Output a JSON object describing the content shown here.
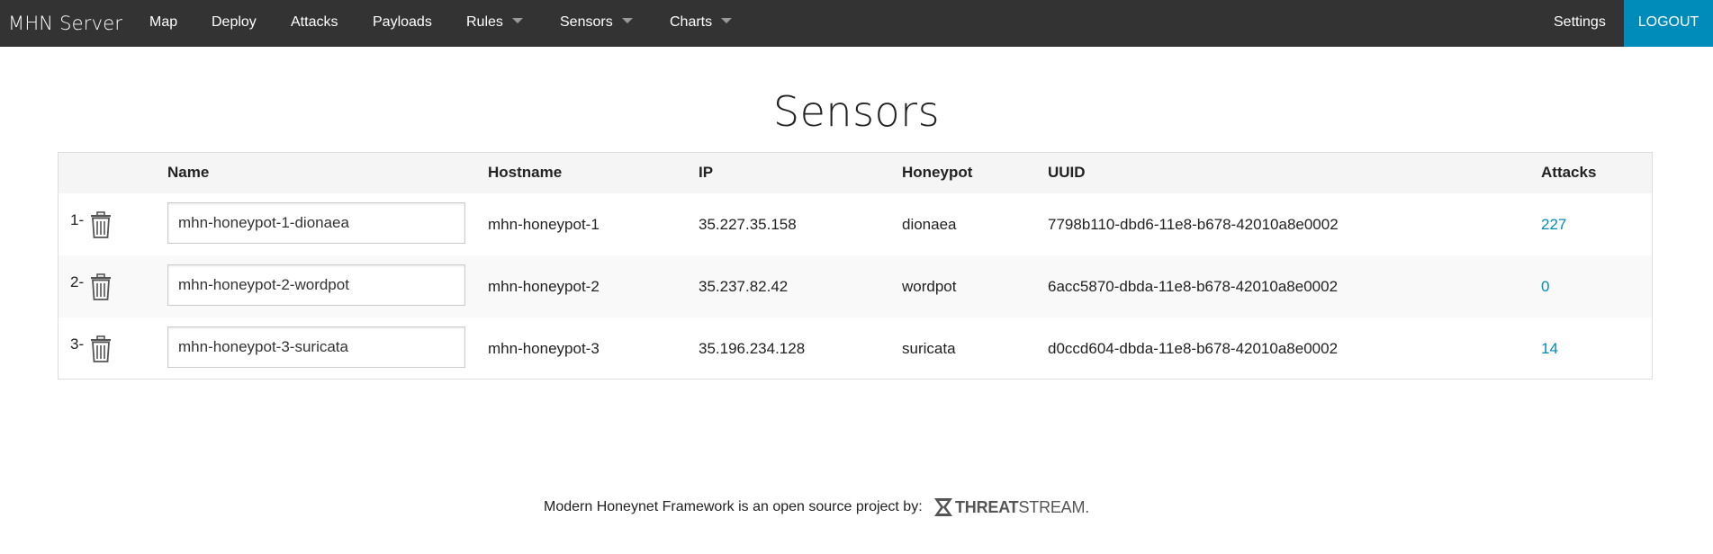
{
  "navbar": {
    "brand": "MHN Server",
    "items": [
      {
        "label": "Map"
      },
      {
        "label": "Deploy"
      },
      {
        "label": "Attacks"
      },
      {
        "label": "Payloads"
      },
      {
        "label": "Rules"
      },
      {
        "label": "Sensors"
      },
      {
        "label": "Charts"
      }
    ],
    "settings": "Settings",
    "logout": "LOGOUT"
  },
  "page": {
    "title": "Sensors"
  },
  "table": {
    "headers": [
      "Name",
      "Hostname",
      "IP",
      "Honeypot",
      "UUID",
      "Attacks"
    ],
    "rows": [
      {
        "num": "1-",
        "name": "mhn-honeypot-1-dionaea",
        "hostname": "mhn-honeypot-1",
        "ip": "35.227.35.158",
        "honeypot": "dionaea",
        "uuid": "7798b110-dbd6-11e8-b678-42010a8e0002",
        "attacks": "227"
      },
      {
        "num": "2-",
        "name": "mhn-honeypot-2-wordpot",
        "hostname": "mhn-honeypot-2",
        "ip": "35.237.82.42",
        "honeypot": "wordpot",
        "uuid": "6acc5870-dbda-11e8-b678-42010a8e0002",
        "attacks": "0"
      },
      {
        "num": "3-",
        "name": "mhn-honeypot-3-suricata",
        "hostname": "mhn-honeypot-3",
        "ip": "35.196.234.128",
        "honeypot": "suricata",
        "uuid": "d0ccd604-dbda-11e8-b678-42010a8e0002",
        "attacks": "14"
      }
    ]
  },
  "footer": {
    "text": "Modern Honeynet Framework is an open source project by:",
    "logo_bold": "THREAT",
    "logo_light": "STREAM."
  },
  "colors": {
    "navbar_bg": "#333333",
    "accent": "#008cba",
    "header_bg": "#f5f5f5"
  }
}
